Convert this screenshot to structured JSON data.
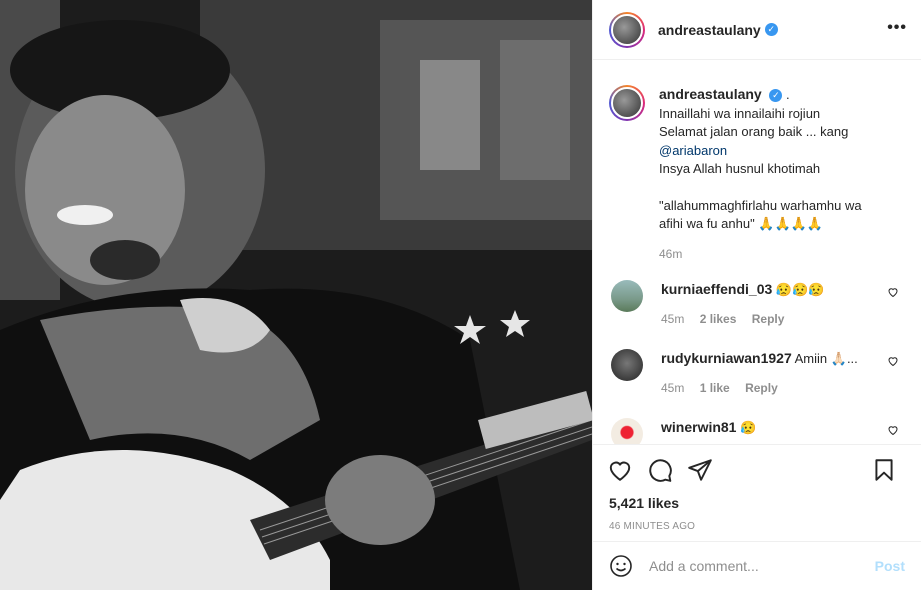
{
  "post": {
    "username": "andreastaulany",
    "verified": true
  },
  "caption": {
    "username": "andreastaulany",
    "suffix": ".",
    "line1": "Innaillahi wa innailaihi rojiun",
    "line2": "Selamat jalan orang baik ... kang",
    "mention": "@ariabaron",
    "line3": "Insya Allah husnul khotimah",
    "line4": "\"allahummaghfirlahu warhamhu wa",
    "line5": "afihi wa fu anhu\" 🙏🙏🙏🙏",
    "age": "46m"
  },
  "comments": [
    {
      "username": "kurniaeffendi_03",
      "text": "😥😥😥",
      "age": "45m",
      "likes": "2 likes",
      "reply": "Reply",
      "avatar_color": "#7a9a8a"
    },
    {
      "username": "rudykurniawan1927",
      "text": "Amiin 🙏🏻...",
      "age": "45m",
      "likes": "1 like",
      "reply": "Reply",
      "avatar_color": "#3a3a3a"
    },
    {
      "username": "winerwin81",
      "text": "😥",
      "age": "",
      "likes": "",
      "reply": "",
      "avatar_color": "#e8e0d6"
    }
  ],
  "engagement": {
    "likes": "5,421 likes",
    "timestamp": "46 MINUTES AGO"
  },
  "add_comment": {
    "placeholder": "Add a comment...",
    "post_label": "Post"
  },
  "colors": {
    "verified_badge": "#3897f0",
    "mention": "#00376b",
    "post_button": "#b2dffc"
  },
  "icons": [
    "more-options-icon",
    "heart-icon",
    "comment-icon",
    "share-icon",
    "bookmark-icon",
    "emoji-icon",
    "verified-icon"
  ]
}
